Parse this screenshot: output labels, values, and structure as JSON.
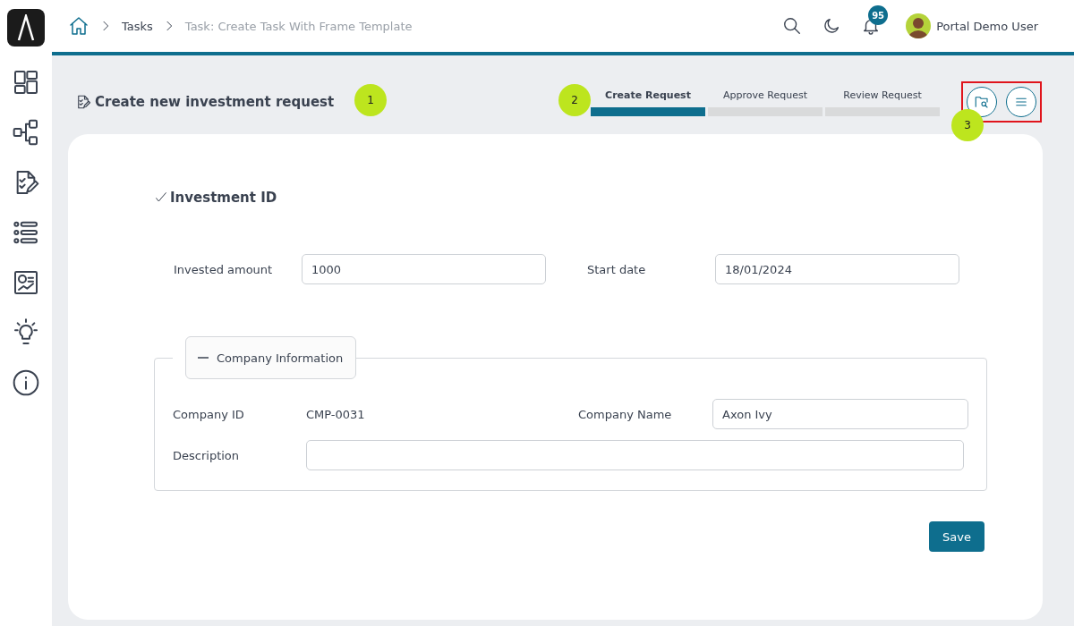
{
  "breadcrumb": [
    {
      "label": "Tasks",
      "current": false
    },
    {
      "label": "Task: Create Task With Frame Template",
      "current": true
    }
  ],
  "header": {
    "notifications": "95",
    "user": "Portal Demo User"
  },
  "page_title": "Create new investment request",
  "steps": [
    {
      "label": "Create Request",
      "selected": true
    },
    {
      "label": "Approve Request",
      "selected": false
    },
    {
      "label": "Review Request",
      "selected": false
    }
  ],
  "annotations": [
    "1",
    "2",
    "3"
  ],
  "section_title": "Investment ID",
  "fields": [
    {
      "label": "Invested amount",
      "value": "1000"
    },
    {
      "label": "Start date",
      "value": "18/01/2024"
    }
  ],
  "company": {
    "legend": "Company Information",
    "expanded": true,
    "id_label": "Company ID",
    "id_value": "CMP-0031",
    "name_label": "Company Name",
    "name_value": "Axon Ivy",
    "description_label": "Description"
  },
  "save": "Save"
}
